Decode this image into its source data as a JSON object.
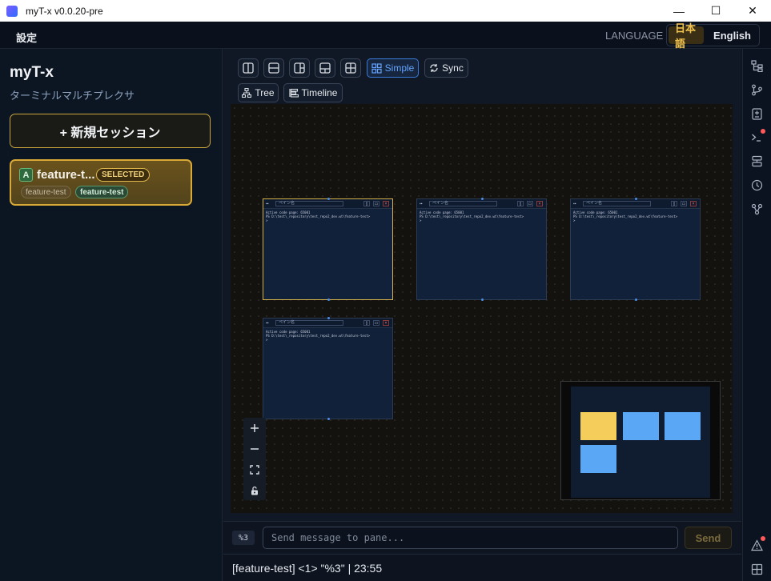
{
  "window": {
    "title": "myT-x v0.0.20-pre",
    "minimize": "—",
    "maximize": "☐",
    "close": "✕"
  },
  "menubar": {
    "settings": "設定",
    "language_label": "LANGUAGE",
    "languages": [
      "日本語",
      "English"
    ],
    "active_language": "日本語"
  },
  "sidebar": {
    "brand": "myT-x",
    "subtitle": "ターミナルマルチプレクサ",
    "new_session": "+ 新規セッション",
    "session": {
      "badge": "A",
      "name": "feature-t...",
      "selected_badge": "SELECTED",
      "branch_tag": "feature-test",
      "worktree_tag": "feature-test"
    }
  },
  "toolbar": {
    "layout_buttons": [
      "split-vertical",
      "split-horizontal",
      "split-right",
      "split-bottom",
      "grid"
    ],
    "simple": "Simple",
    "sync": "Sync",
    "tree": "Tree",
    "timeline": "Timeline",
    "active": "Simple"
  },
  "panes": [
    {
      "title": "ペイン名",
      "lines": [
        "Active code page: 65001",
        "PS D:\\test\\_repository\\test_repo2_dev.wt\\feature-test>",
        "> "
      ],
      "selected": true
    },
    {
      "title": "ペイン名",
      "lines": [
        "Active code page: 65001",
        "PS D:\\test\\_repository\\test_repo2_dev.wt\\feature-test>",
        "> "
      ],
      "selected": false
    },
    {
      "title": "ペイン名",
      "lines": [
        "Active code page: 65001",
        "PS D:\\test\\_repository\\test_repo2_dev.wt\\feature-test>",
        "> "
      ],
      "selected": false
    },
    {
      "title": "ペイン名",
      "lines": [
        "Active code page: 65001",
        "PS D:\\test\\_repository\\test_repo2_dev.wt\\feature-test>",
        "> "
      ],
      "selected": false
    }
  ],
  "zoom_controls": [
    "zoom-in",
    "zoom-out",
    "fit-view",
    "lock"
  ],
  "minimap": {
    "colors": {
      "selected": "#f5cd5b",
      "other": "#5aa8f5"
    }
  },
  "prompt": {
    "pane_id": "%3",
    "placeholder": "Send message to pane...",
    "value": "",
    "send": "Send"
  },
  "status": {
    "text": "[feature-test] <1> \"%3\" | 23:55"
  },
  "rail": {
    "icons": [
      "tree-icon",
      "git-branch-icon",
      "diff-icon",
      "terminal-alert-icon",
      "layout-icon",
      "history-icon",
      "network-icon"
    ],
    "bottom_icons": [
      "warning-icon",
      "grid-icon"
    ]
  },
  "colors": {
    "accent": "#f2c34e",
    "active_blue": "#63a3ff"
  }
}
